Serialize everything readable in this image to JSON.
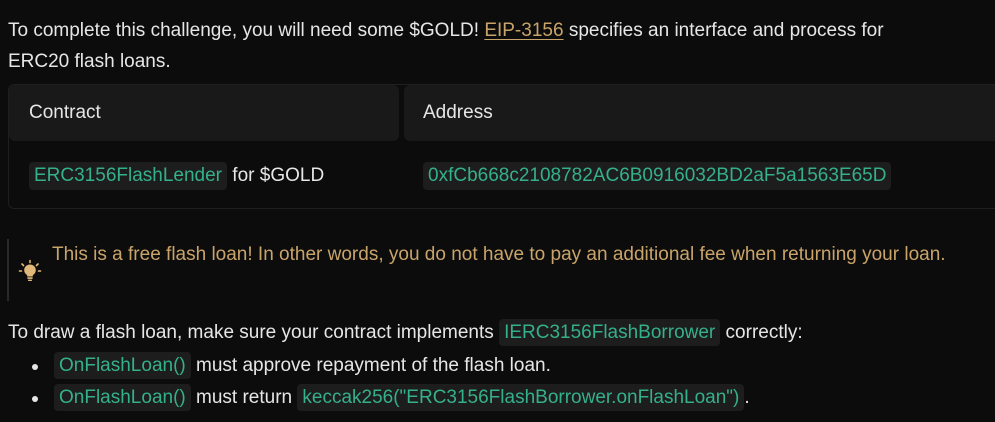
{
  "intro": {
    "before": "To complete this challenge, you will need some $GOLD! ",
    "link": "EIP-3156",
    "after": " specifies an interface and process for",
    "line2": "ERC20 flash loans."
  },
  "table": {
    "headers": [
      "Contract",
      "Address"
    ],
    "row": {
      "contract": "ERC3156FlashLender",
      "contract_suffix": " for $GOLD",
      "address": "0xfCb668c2108782AC6B0916032BD2aF5a1563E65D"
    }
  },
  "callout": {
    "icon": "lightbulb-icon",
    "text": "This is a free flash loan! In other words, you do not have to pay an additional fee when returning your loan."
  },
  "draw": {
    "before": "To draw a flash loan, make sure your contract implements ",
    "code": "IERC3156FlashBorrower",
    "after": " correctly:"
  },
  "bullets": [
    {
      "code": "OnFlashLoan()",
      "text": " must approve repayment of the flash loan."
    },
    {
      "code": "OnFlashLoan()",
      "text": " must return ",
      "code2": "keccak256(\"ERC3156FlashBorrower.onFlashLoan\")",
      "end": "."
    }
  ],
  "colors": {
    "background": "#0c0c0c",
    "code_text": "#34b08a",
    "callout_text": "#c9a46a"
  }
}
